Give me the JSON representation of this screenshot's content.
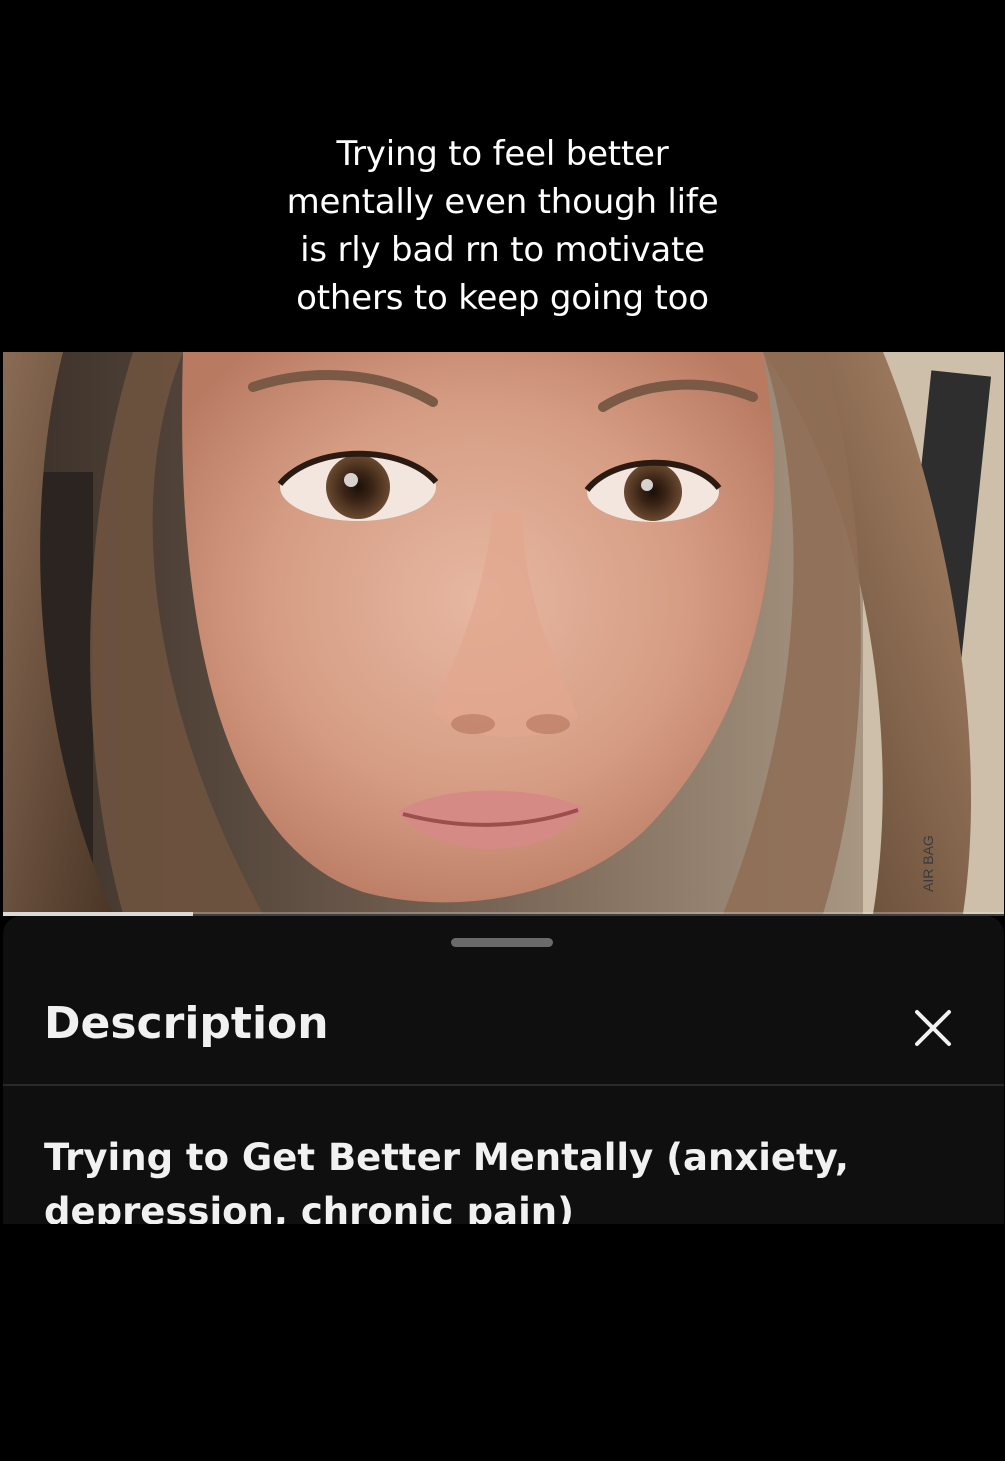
{
  "overlay_caption": {
    "lines": [
      "Trying to feel better",
      "mentally even though life",
      "is rly bad rn to motivate",
      "others to keep going too"
    ]
  },
  "video": {
    "progress_fraction": 0.19,
    "background_text": "AIR BAG"
  },
  "description_sheet": {
    "title": "Description",
    "close_icon": "close-x-icon",
    "text": "Trying to Get Better Mentally (anxiety, depression, chronic pain)"
  },
  "colors": {
    "sheet_background": "#0f0f0f",
    "text_primary": "#f1f1f1",
    "handle": "#6a6a6a"
  }
}
